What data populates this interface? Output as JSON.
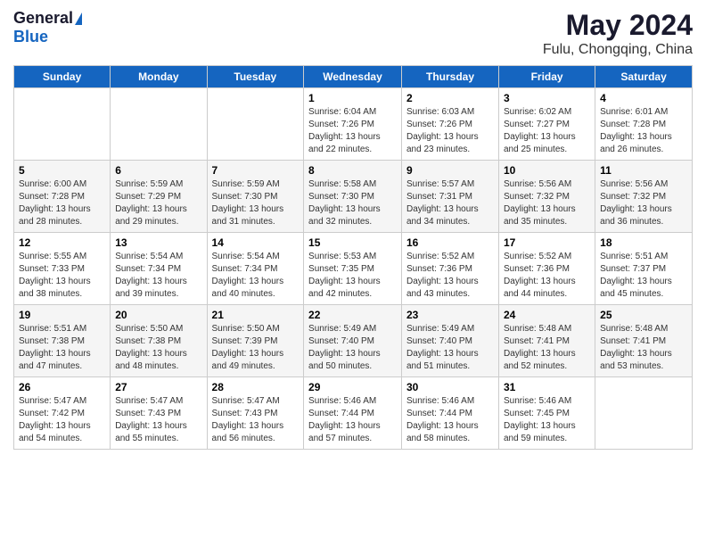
{
  "logo": {
    "general": "General",
    "blue": "Blue"
  },
  "title": "May 2024",
  "location": "Fulu, Chongqing, China",
  "weekdays": [
    "Sunday",
    "Monday",
    "Tuesday",
    "Wednesday",
    "Thursday",
    "Friday",
    "Saturday"
  ],
  "weeks": [
    [
      {
        "day": "",
        "info": ""
      },
      {
        "day": "",
        "info": ""
      },
      {
        "day": "",
        "info": ""
      },
      {
        "day": "1",
        "info": "Sunrise: 6:04 AM\nSunset: 7:26 PM\nDaylight: 13 hours\nand 22 minutes."
      },
      {
        "day": "2",
        "info": "Sunrise: 6:03 AM\nSunset: 7:26 PM\nDaylight: 13 hours\nand 23 minutes."
      },
      {
        "day": "3",
        "info": "Sunrise: 6:02 AM\nSunset: 7:27 PM\nDaylight: 13 hours\nand 25 minutes."
      },
      {
        "day": "4",
        "info": "Sunrise: 6:01 AM\nSunset: 7:28 PM\nDaylight: 13 hours\nand 26 minutes."
      }
    ],
    [
      {
        "day": "5",
        "info": "Sunrise: 6:00 AM\nSunset: 7:28 PM\nDaylight: 13 hours\nand 28 minutes."
      },
      {
        "day": "6",
        "info": "Sunrise: 5:59 AM\nSunset: 7:29 PM\nDaylight: 13 hours\nand 29 minutes."
      },
      {
        "day": "7",
        "info": "Sunrise: 5:59 AM\nSunset: 7:30 PM\nDaylight: 13 hours\nand 31 minutes."
      },
      {
        "day": "8",
        "info": "Sunrise: 5:58 AM\nSunset: 7:30 PM\nDaylight: 13 hours\nand 32 minutes."
      },
      {
        "day": "9",
        "info": "Sunrise: 5:57 AM\nSunset: 7:31 PM\nDaylight: 13 hours\nand 34 minutes."
      },
      {
        "day": "10",
        "info": "Sunrise: 5:56 AM\nSunset: 7:32 PM\nDaylight: 13 hours\nand 35 minutes."
      },
      {
        "day": "11",
        "info": "Sunrise: 5:56 AM\nSunset: 7:32 PM\nDaylight: 13 hours\nand 36 minutes."
      }
    ],
    [
      {
        "day": "12",
        "info": "Sunrise: 5:55 AM\nSunset: 7:33 PM\nDaylight: 13 hours\nand 38 minutes."
      },
      {
        "day": "13",
        "info": "Sunrise: 5:54 AM\nSunset: 7:34 PM\nDaylight: 13 hours\nand 39 minutes."
      },
      {
        "day": "14",
        "info": "Sunrise: 5:54 AM\nSunset: 7:34 PM\nDaylight: 13 hours\nand 40 minutes."
      },
      {
        "day": "15",
        "info": "Sunrise: 5:53 AM\nSunset: 7:35 PM\nDaylight: 13 hours\nand 42 minutes."
      },
      {
        "day": "16",
        "info": "Sunrise: 5:52 AM\nSunset: 7:36 PM\nDaylight: 13 hours\nand 43 minutes."
      },
      {
        "day": "17",
        "info": "Sunrise: 5:52 AM\nSunset: 7:36 PM\nDaylight: 13 hours\nand 44 minutes."
      },
      {
        "day": "18",
        "info": "Sunrise: 5:51 AM\nSunset: 7:37 PM\nDaylight: 13 hours\nand 45 minutes."
      }
    ],
    [
      {
        "day": "19",
        "info": "Sunrise: 5:51 AM\nSunset: 7:38 PM\nDaylight: 13 hours\nand 47 minutes."
      },
      {
        "day": "20",
        "info": "Sunrise: 5:50 AM\nSunset: 7:38 PM\nDaylight: 13 hours\nand 48 minutes."
      },
      {
        "day": "21",
        "info": "Sunrise: 5:50 AM\nSunset: 7:39 PM\nDaylight: 13 hours\nand 49 minutes."
      },
      {
        "day": "22",
        "info": "Sunrise: 5:49 AM\nSunset: 7:40 PM\nDaylight: 13 hours\nand 50 minutes."
      },
      {
        "day": "23",
        "info": "Sunrise: 5:49 AM\nSunset: 7:40 PM\nDaylight: 13 hours\nand 51 minutes."
      },
      {
        "day": "24",
        "info": "Sunrise: 5:48 AM\nSunset: 7:41 PM\nDaylight: 13 hours\nand 52 minutes."
      },
      {
        "day": "25",
        "info": "Sunrise: 5:48 AM\nSunset: 7:41 PM\nDaylight: 13 hours\nand 53 minutes."
      }
    ],
    [
      {
        "day": "26",
        "info": "Sunrise: 5:47 AM\nSunset: 7:42 PM\nDaylight: 13 hours\nand 54 minutes."
      },
      {
        "day": "27",
        "info": "Sunrise: 5:47 AM\nSunset: 7:43 PM\nDaylight: 13 hours\nand 55 minutes."
      },
      {
        "day": "28",
        "info": "Sunrise: 5:47 AM\nSunset: 7:43 PM\nDaylight: 13 hours\nand 56 minutes."
      },
      {
        "day": "29",
        "info": "Sunrise: 5:46 AM\nSunset: 7:44 PM\nDaylight: 13 hours\nand 57 minutes."
      },
      {
        "day": "30",
        "info": "Sunrise: 5:46 AM\nSunset: 7:44 PM\nDaylight: 13 hours\nand 58 minutes."
      },
      {
        "day": "31",
        "info": "Sunrise: 5:46 AM\nSunset: 7:45 PM\nDaylight: 13 hours\nand 59 minutes."
      },
      {
        "day": "",
        "info": ""
      }
    ]
  ]
}
